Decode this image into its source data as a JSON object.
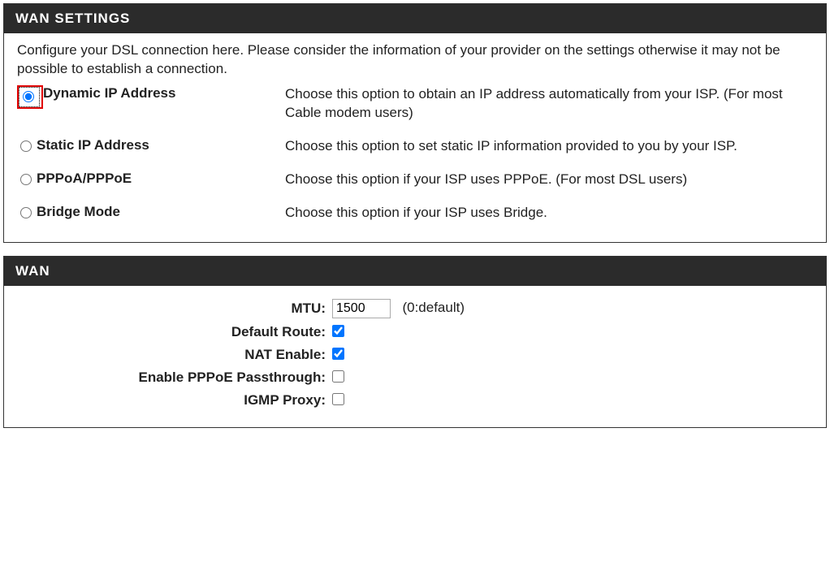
{
  "wan_settings": {
    "title": "WAN SETTINGS",
    "intro": "Configure your DSL connection here. Please consider the information of your provider on the settings otherwise it may not be possible to establish a connection.",
    "options": [
      {
        "label": "Dynamic IP Address",
        "desc": "Choose this option to obtain an IP address automatically from your ISP. (For most Cable modem users)",
        "checked": true,
        "highlighted": true
      },
      {
        "label": "Static IP Address",
        "desc": "Choose this option to set static IP information provided to you by your ISP.",
        "checked": false,
        "highlighted": false
      },
      {
        "label": "PPPoA/PPPoE",
        "desc": "Choose this option if your ISP uses PPPoE. (For most DSL users)",
        "checked": false,
        "highlighted": false
      },
      {
        "label": "Bridge Mode",
        "desc": "Choose this option if your ISP uses Bridge.",
        "checked": false,
        "highlighted": false
      }
    ]
  },
  "wan": {
    "title": "WAN",
    "mtu_label": "MTU:",
    "mtu_value": "1500",
    "mtu_hint": "(0:default)",
    "default_route_label": "Default Route:",
    "default_route_checked": true,
    "nat_enable_label": "NAT Enable:",
    "nat_enable_checked": true,
    "pppoe_passthrough_label": "Enable PPPoE Passthrough:",
    "pppoe_passthrough_checked": false,
    "igmp_proxy_label": "IGMP Proxy:",
    "igmp_proxy_checked": false
  }
}
